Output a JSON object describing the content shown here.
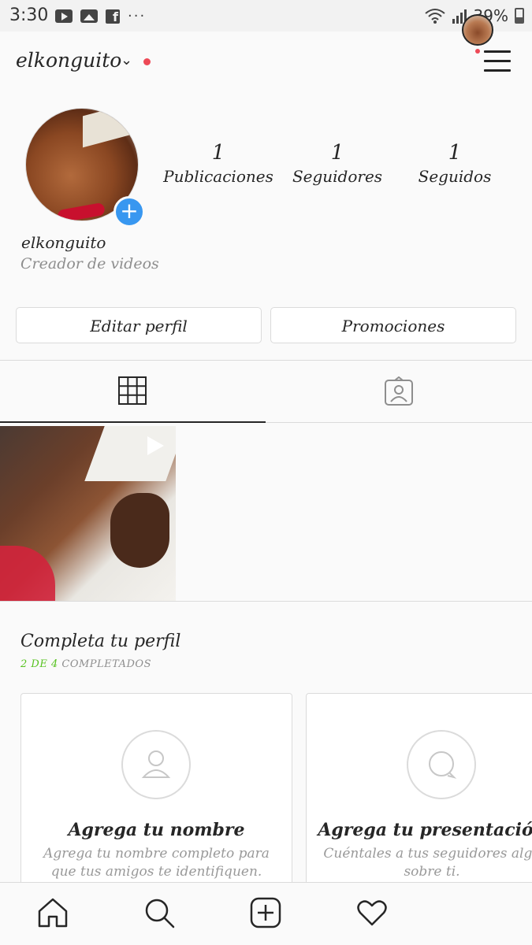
{
  "status_bar": {
    "time": "3:30",
    "icons_left": [
      "youtube-icon",
      "image-icon",
      "facebook-icon",
      "more-icon"
    ],
    "facebook_letter": "f",
    "more": "···",
    "battery": "39%",
    "icons_right": [
      "wifi-icon",
      "signal-icon",
      "battery-icon"
    ]
  },
  "header": {
    "username": "elkonguito",
    "has_notification_dot": true
  },
  "profile": {
    "add_badge": "+",
    "stats": [
      {
        "value": "1",
        "label": "Publicaciones"
      },
      {
        "value": "1",
        "label": "Seguidores"
      },
      {
        "value": "1",
        "label": "Seguidos"
      }
    ],
    "name": "elkonguito",
    "category": "Creador de videos"
  },
  "actions": {
    "edit_profile": "Editar perfil",
    "promotions": "Promociones"
  },
  "tabs": [
    {
      "icon": "grid-icon",
      "active": true
    },
    {
      "icon": "tagged-icon",
      "active": false
    }
  ],
  "posts": [
    {
      "type": "video",
      "icon": "play-icon"
    }
  ],
  "complete_profile": {
    "title": "Completa tu perfil",
    "progress_count": "2 DE 4",
    "progress_suffix": "COMPLETADOS",
    "cards": [
      {
        "icon": "person-icon",
        "title": "Agrega tu nombre",
        "description": "Agrega tu nombre completo para que tus amigos te identifiquen."
      },
      {
        "icon": "speech-bubble-icon",
        "title": "Agrega tu presentación",
        "description": "Cuéntales a tus seguidores algo sobre ti."
      }
    ]
  },
  "bottom_nav": [
    "home-icon",
    "search-icon",
    "new-post-icon",
    "activity-icon",
    "profile-avatar"
  ],
  "colors": {
    "accent_blue": "#3897f0",
    "notification_red": "#ed4956",
    "progress_green": "#58c322",
    "border": "#dbdbdb"
  }
}
